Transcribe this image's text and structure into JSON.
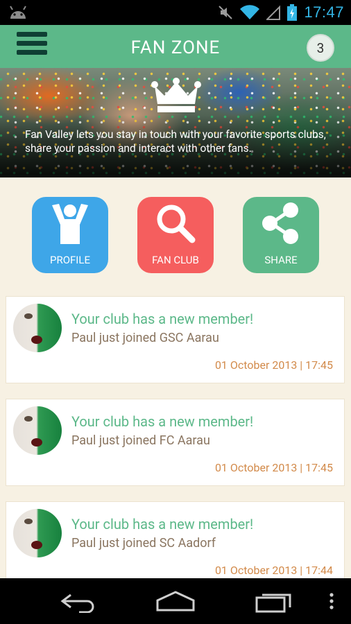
{
  "status_bar": {
    "time": "17:47",
    "icons": [
      "android-icon",
      "mute-icon",
      "wifi-icon",
      "signal-icon",
      "battery-charging-icon"
    ]
  },
  "app_bar": {
    "title": "FAN ZONE",
    "notification_count": "3"
  },
  "hero": {
    "text": "Fan Valley lets you stay in touch with your favorite sports clubs, share your passion and interact with other fans."
  },
  "actions": [
    {
      "label": "PROFILE",
      "icon": "person-cheering-icon",
      "color": "#3ea6e8"
    },
    {
      "label": "FAN CLUB",
      "icon": "search-icon",
      "color": "#f55e5e"
    },
    {
      "label": "SHARE",
      "icon": "share-icon",
      "color": "#5cb889"
    }
  ],
  "feed": [
    {
      "title": "Your club has a new member!",
      "subtitle": "Paul just joined GSC Aarau",
      "time": "01 October 2013 | 17:45"
    },
    {
      "title": "Your club has a new member!",
      "subtitle": "Paul just joined FC Aarau",
      "time": "01 October 2013 | 17:45"
    },
    {
      "title": "Your club has a new member!",
      "subtitle": "Paul just joined SC Aadorf",
      "time": "01 October 2013 | 17:44"
    }
  ],
  "colors": {
    "accent_green": "#5cb889",
    "profile_blue": "#3ea6e8",
    "fanclub_red": "#f55e5e",
    "timestamp_orange": "#d28a4a",
    "subtitle_brown": "#8a7560"
  }
}
